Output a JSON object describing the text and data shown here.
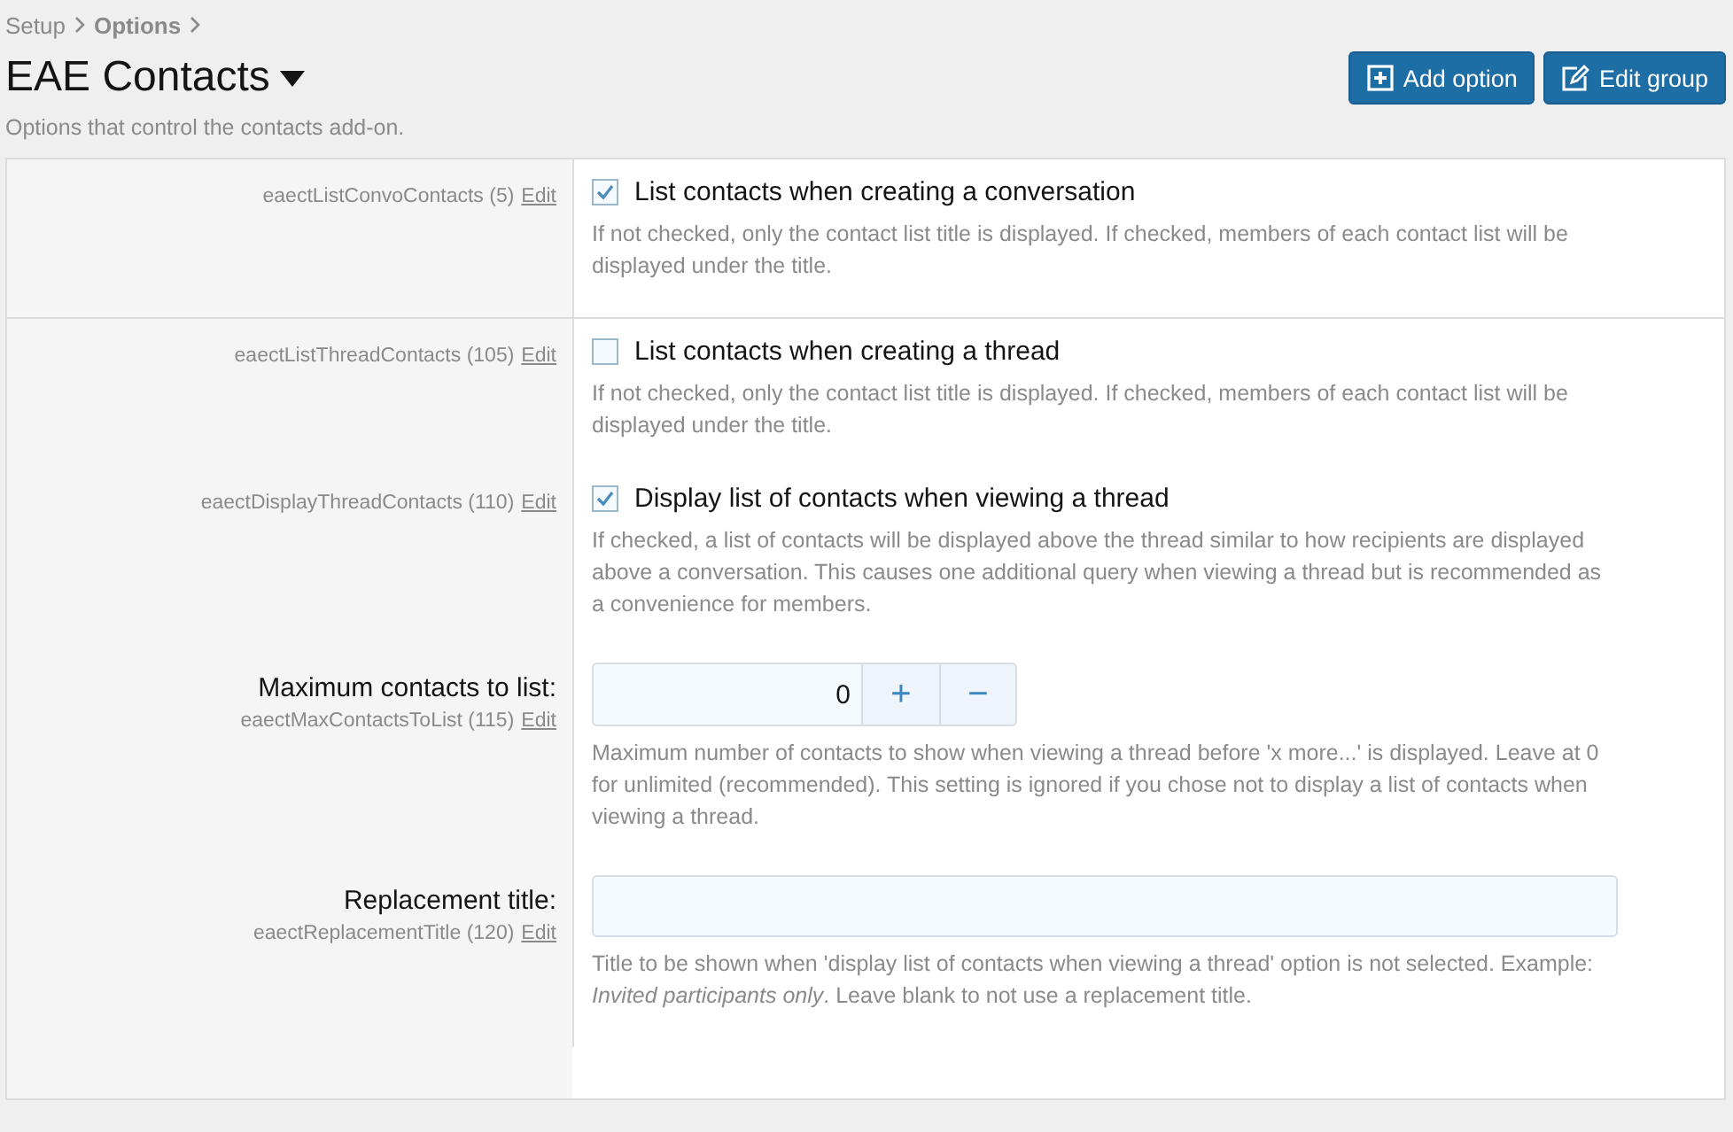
{
  "breadcrumb": [
    {
      "label": "Setup",
      "current": false
    },
    {
      "label": "Options",
      "current": true
    }
  ],
  "title": "EAE Contacts",
  "description": "Options that control the contacts add-on.",
  "buttons": [
    {
      "kind": "add",
      "label": "Add option"
    },
    {
      "kind": "edit",
      "label": "Edit group"
    }
  ],
  "groups": [
    [
      {
        "kind": "checkbox",
        "key_text": "eaectListConvoContacts (5)",
        "edit_link": "Edit",
        "label": "List contacts when creating a conversation",
        "checked": true,
        "explain": "If not checked, only the contact list title is displayed. If checked, members of each contact list will be displayed under the title."
      }
    ],
    [
      {
        "kind": "checkbox",
        "key_text": "eaectListThreadContacts (105)",
        "edit_link": "Edit",
        "label": "List contacts when creating a thread",
        "checked": false,
        "explain": "If not checked, only the contact list title is displayed. If checked, members of each contact list will be displayed under the title."
      },
      {
        "kind": "checkbox",
        "key_text": "eaectDisplayThreadContacts (110)",
        "edit_link": "Edit",
        "label": "Display list of contacts when viewing a thread",
        "checked": true,
        "explain": "If checked, a list of contacts will be displayed above the thread similar to how recipients are displayed above a conversation. This causes one additional query when viewing a thread but is recommended as a convenience for members."
      },
      {
        "kind": "spinbox",
        "title": "Maximum contacts to list:",
        "key_text": "eaectMaxContactsToList (115)",
        "edit_link": "Edit",
        "value": "0",
        "increment": "+",
        "decrement": "−",
        "explain": "Maximum number of contacts to show when viewing a thread before 'x more...' is displayed. Leave at 0 for unlimited (recommended). This setting is ignored if you chose not to display a list of contacts when viewing a thread."
      },
      {
        "kind": "textbox",
        "title": "Replacement title:",
        "key_text": "eaectReplacementTitle (120)",
        "edit_link": "Edit",
        "explain": "Title to be shown when 'display list of contacts when viewing a thread' option is not selected. Example: *Invited participants only*. Leave blank to not use a replacement title."
      }
    ]
  ]
}
